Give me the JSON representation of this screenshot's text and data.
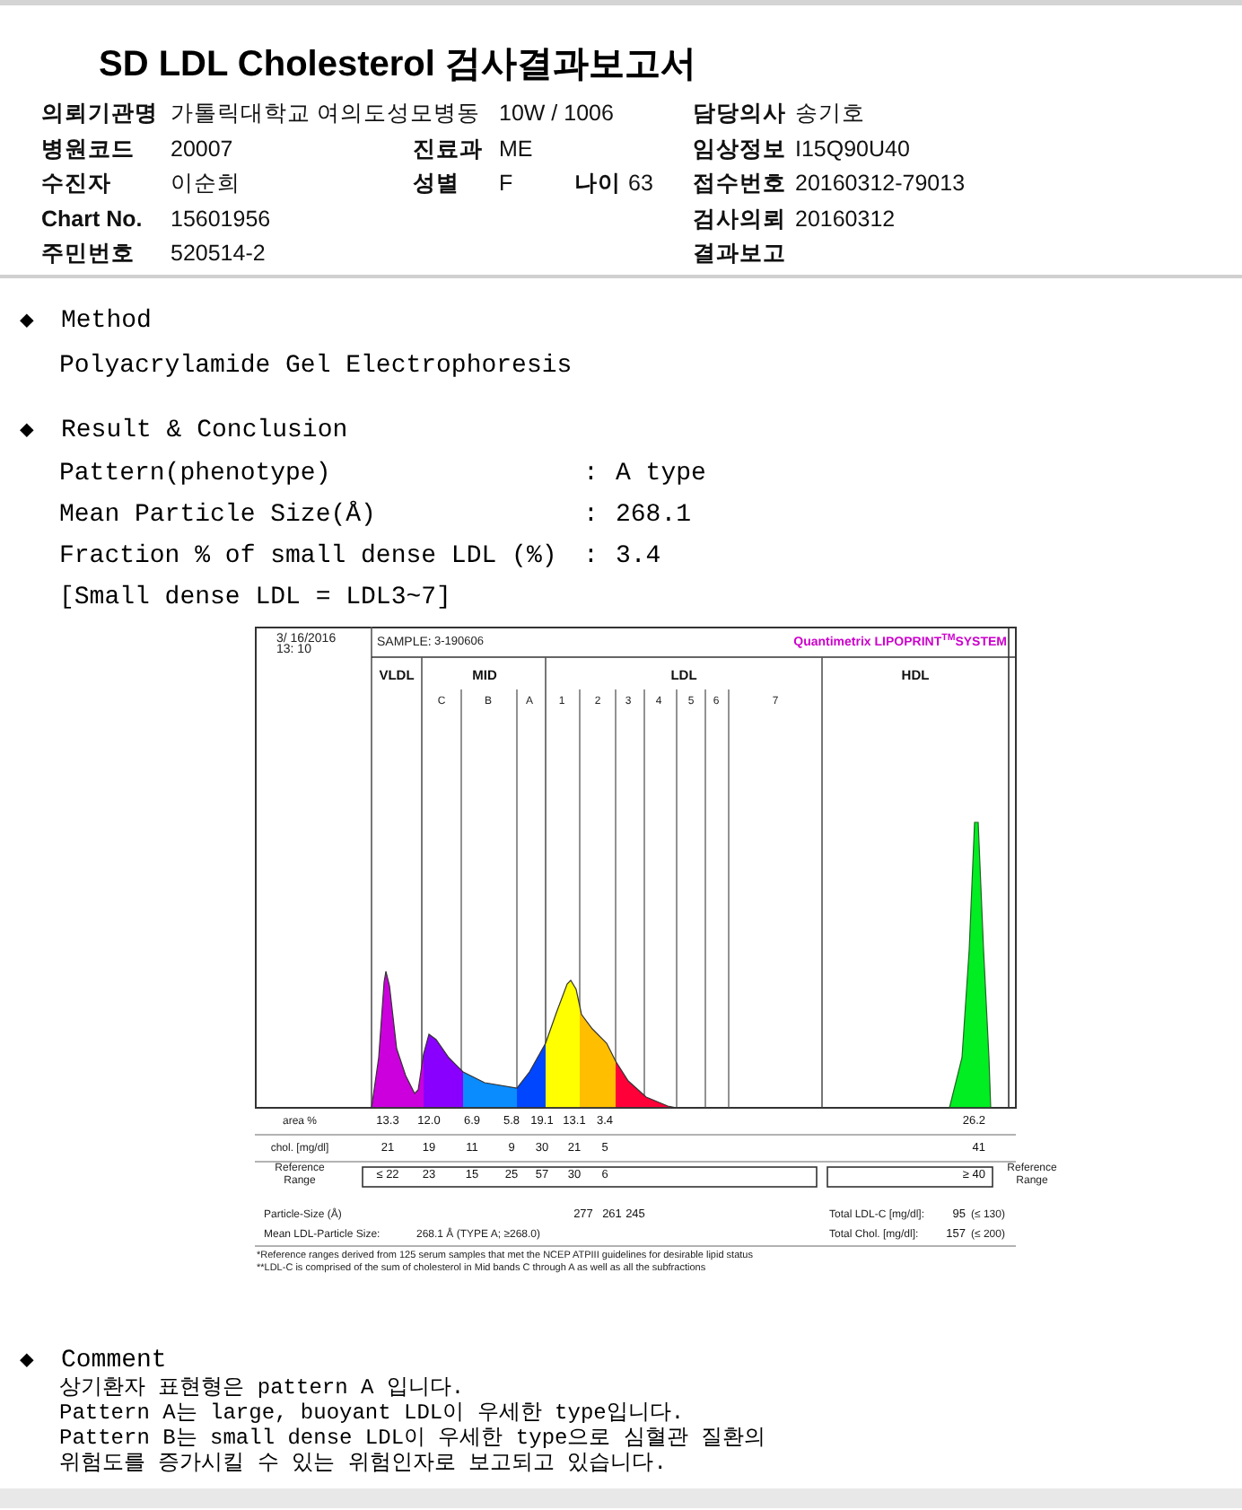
{
  "title": "SD LDL Cholesterol 검사결과보고서",
  "info_rows": [
    {
      "left": {
        "label": "의뢰기관명",
        "value": "가톨릭대학교 여의도성모병동"
      },
      "middle": [
        {
          "value": "10W / 1006"
        }
      ],
      "right": {
        "label": "담당의사",
        "value": "송기호"
      }
    },
    {
      "left": {
        "label": "병원코드",
        "value": "20007"
      },
      "middle": [
        {
          "label": "진료과",
          "value": "ME"
        }
      ],
      "right": {
        "label": "임상정보",
        "value": "I15Q90U40"
      }
    },
    {
      "left": {
        "label": "수진자",
        "value": "이순희"
      },
      "middle": [
        {
          "label": "성별",
          "value": "F"
        },
        {
          "label": "나이",
          "value": "63"
        }
      ],
      "right": {
        "label": "접수번호",
        "value": "20160312-79013"
      }
    },
    {
      "left": {
        "label": "Chart No.",
        "value": "15601956"
      },
      "right": {
        "label": "검사의뢰",
        "value": "20160312"
      }
    },
    {
      "left": {
        "label": "주민번호",
        "value": "520514-2"
      },
      "right": {
        "label": "결과보고"
      }
    }
  ],
  "sections": [
    {
      "kind": "text",
      "bullet": "◆",
      "heading": "Method",
      "text": "Polyacrylamide Gel Electrophoresis"
    },
    {
      "kind": "result",
      "bullet": "◆",
      "heading": "Result & Conclusion",
      "rows": [
        {
          "label": "Pattern(phenotype)",
          "sep": ":",
          "value": "A type"
        },
        {
          "label": "Mean Particle Size(Å)",
          "sep": ":",
          "value": "268.1"
        },
        {
          "label": "Fraction % of small dense LDL (%)",
          "sep": ":",
          "value": "3.4"
        }
      ],
      "note": "[Small dense LDL = LDL3~7]"
    },
    {
      "kind": "report_image",
      "date": "3/ 16/2016",
      "time": "13: 10",
      "sample_label": "SAMPLE:",
      "sample_id": "3-190606",
      "brand": "Quantimetrix LIPOPRINT$^{TM}$SYSTEM",
      "groups": [
        "VLDL",
        "MID",
        "LDL",
        "HDL"
      ],
      "subbands": [
        "C",
        "B",
        "A",
        "1",
        "2",
        "3",
        "4",
        "5",
        "6",
        "7"
      ],
      "table": [
        {
          "kind": "plain",
          "label": "area %",
          "values": [
            "13.3",
            "12.0",
            "6.9",
            "5.8",
            "19.1",
            "13.1",
            "3.4"
          ],
          "hdl": "26.2"
        },
        {
          "kind": "plain",
          "label": "chol. [mg/dl]",
          "values": [
            "21",
            "19",
            "11",
            "9",
            "30",
            "21",
            "5"
          ],
          "hdl": "41"
        },
        {
          "kind": "reference",
          "label": "Reference Range",
          "values": [
            "≤ 22",
            "23",
            "15",
            "25",
            "57",
            "30",
            "6"
          ],
          "hdl": "≥ 40",
          "right_label": "Reference Range"
        }
      ],
      "particle_label": "Particle-Size (Å)",
      "particle_sizes": [
        "277",
        "261",
        "245"
      ],
      "mean_label": "Mean LDL-Particle Size:",
      "mean_value": "268.1 Å  (TYPE A; ≥268.0)",
      "totals": [
        {
          "label": "Total LDL-C [mg/dl]:",
          "value": "95",
          "range": "(≤ 130)"
        },
        {
          "label": "Total Chol. [mg/dl]:",
          "value": "157",
          "range": "(≤ 200)"
        }
      ],
      "footnotes": [
        "*Reference ranges derived from 125 serum samples that met the NCEP ATPIII guidelines for desirable lipid status",
        "**LDL-C is comprised of the sum of cholesterol in Mid bands C through A as well as all the subfractions"
      ]
    },
    {
      "kind": "comment",
      "bullet": "◆",
      "heading": "Comment",
      "lines": [
        "상기환자 표현형은 pattern A 입니다.",
        "Pattern A는 large, buoyant LDL이 우세한 type입니다.",
        "Pattern B는 small dense LDL이 우세한 type으로 심혈관 질환의",
        "위험도를 증가시킬 수 있는 위험인자로 보고되고 있습니다."
      ]
    }
  ]
}
